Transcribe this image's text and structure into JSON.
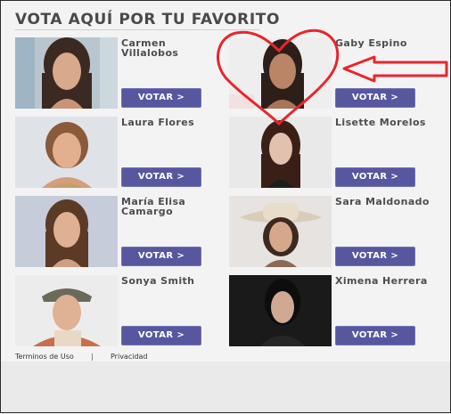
{
  "header": {
    "title": "VOTA AQUÍ POR TU FAVORITO"
  },
  "vote_label": "VOTAR >",
  "candidates": [
    {
      "name": "Carmen Villalobos"
    },
    {
      "name": "Gaby Espino"
    },
    {
      "name": "Laura Flores"
    },
    {
      "name": "Lisette Morelos"
    },
    {
      "name": "María Elisa Camargo"
    },
    {
      "name": "Sara Maldonado"
    },
    {
      "name": "Sonya Smith"
    },
    {
      "name": "Ximena Herrera"
    }
  ],
  "footer": {
    "terms": "Terminos de Uso",
    "separator": "|",
    "privacy": "Privacidad"
  },
  "colors": {
    "button": "#56579e",
    "heart": "#e8262c",
    "arrow": "#e8262c",
    "title": "#4a4a4a"
  },
  "icons": {
    "heart": "heart-outline-icon",
    "arrow": "left-arrow-icon"
  }
}
